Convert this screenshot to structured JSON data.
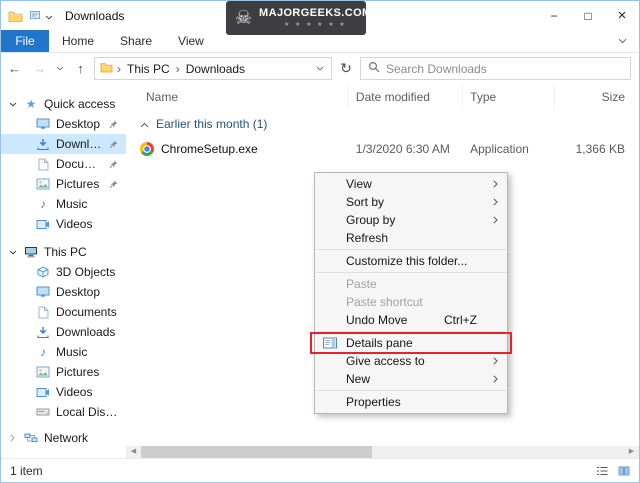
{
  "icons": {
    "back": "←",
    "forward": "→",
    "up": "↑",
    "refresh": "↻",
    "chevron_right": "›",
    "minimize": "−",
    "maximize": "□",
    "close": "×",
    "skull": "☠",
    "star": "★",
    "music_note": "♪",
    "triangle_left": "◀",
    "triangle_right": "▶"
  },
  "titlebar": {
    "title": "Downloads"
  },
  "watermark": {
    "title": "MAJORGEEKS.COM",
    "stars": "★ ★ ★ ★ ★ ★"
  },
  "ribbon": {
    "file_tab": "File",
    "tabs": [
      {
        "label": "Home"
      },
      {
        "label": "Share"
      },
      {
        "label": "View"
      }
    ]
  },
  "addressbar": {
    "breadcrumb": [
      {
        "label": "This PC"
      },
      {
        "label": "Downloads"
      }
    ],
    "search_placeholder": "Search Downloads"
  },
  "columns": [
    {
      "label": "Name"
    },
    {
      "label": "Date modified"
    },
    {
      "label": "Type"
    },
    {
      "label": "Size"
    }
  ],
  "list": {
    "group_header": "Earlier this month (1)",
    "files": [
      {
        "name": "ChromeSetup.exe",
        "date_modified": "1/3/2020 6:30 AM",
        "type": "Application",
        "size": "1,366 KB"
      }
    ]
  },
  "sidebar": {
    "quick_access": {
      "label": "Quick access",
      "items": [
        {
          "label": "Desktop",
          "pinned": true
        },
        {
          "label": "Downloads",
          "pinned": true,
          "selected": true
        },
        {
          "label": "Documents",
          "pinned": true
        },
        {
          "label": "Pictures",
          "pinned": true
        },
        {
          "label": "Music"
        },
        {
          "label": "Videos"
        }
      ]
    },
    "this_pc": {
      "label": "This PC",
      "items": [
        {
          "label": "3D Objects"
        },
        {
          "label": "Desktop"
        },
        {
          "label": "Documents"
        },
        {
          "label": "Downloads"
        },
        {
          "label": "Music"
        },
        {
          "label": "Pictures"
        },
        {
          "label": "Videos"
        },
        {
          "label": "Local Disk (C:)"
        }
      ]
    },
    "network": {
      "label": "Network"
    }
  },
  "context_menu": {
    "items": [
      {
        "label": "View",
        "submenu": true
      },
      {
        "label": "Sort by",
        "submenu": true
      },
      {
        "label": "Group by",
        "submenu": true
      },
      {
        "label": "Refresh"
      },
      {
        "label": "Customize this folder..."
      },
      {
        "label": "Paste",
        "disabled": true
      },
      {
        "label": "Paste shortcut",
        "disabled": true
      },
      {
        "label": "Undo Move",
        "shortcut": "Ctrl+Z"
      },
      {
        "label": "Details pane",
        "highlighted": true
      },
      {
        "label": "Give access to",
        "submenu": true
      },
      {
        "label": "New",
        "submenu": true
      },
      {
        "label": "Properties"
      }
    ]
  },
  "statusbar": {
    "items_count": "1 item"
  }
}
